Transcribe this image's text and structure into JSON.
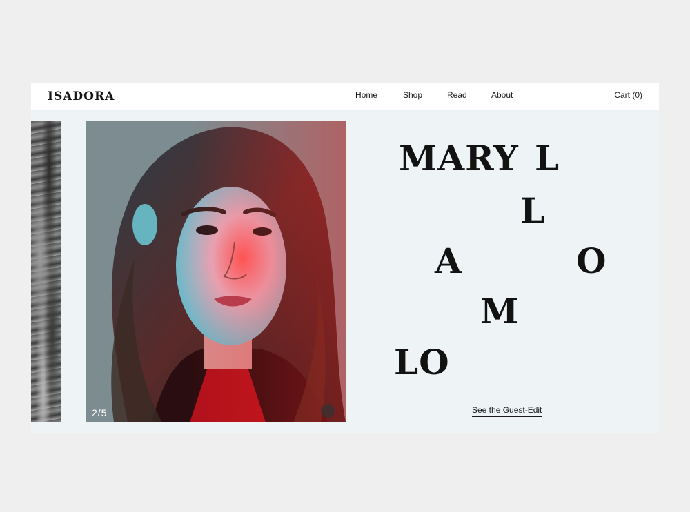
{
  "header": {
    "logo": "ISADORA",
    "nav": [
      "Home",
      "Shop",
      "Read",
      "About"
    ],
    "cart": "Cart (0)"
  },
  "slider": {
    "counter": "2/5"
  },
  "hero": {
    "letters": {
      "mary": "MARY",
      "l1": "L",
      "l2": "L",
      "a": "A",
      "o": "O",
      "m": "M",
      "lo": "LO"
    },
    "cta": "See the Guest-Edit"
  },
  "colors": {
    "page_background": "#efefef",
    "panel_background": "#eef4f5",
    "header_background": "#ffffff",
    "text": "#121212"
  }
}
